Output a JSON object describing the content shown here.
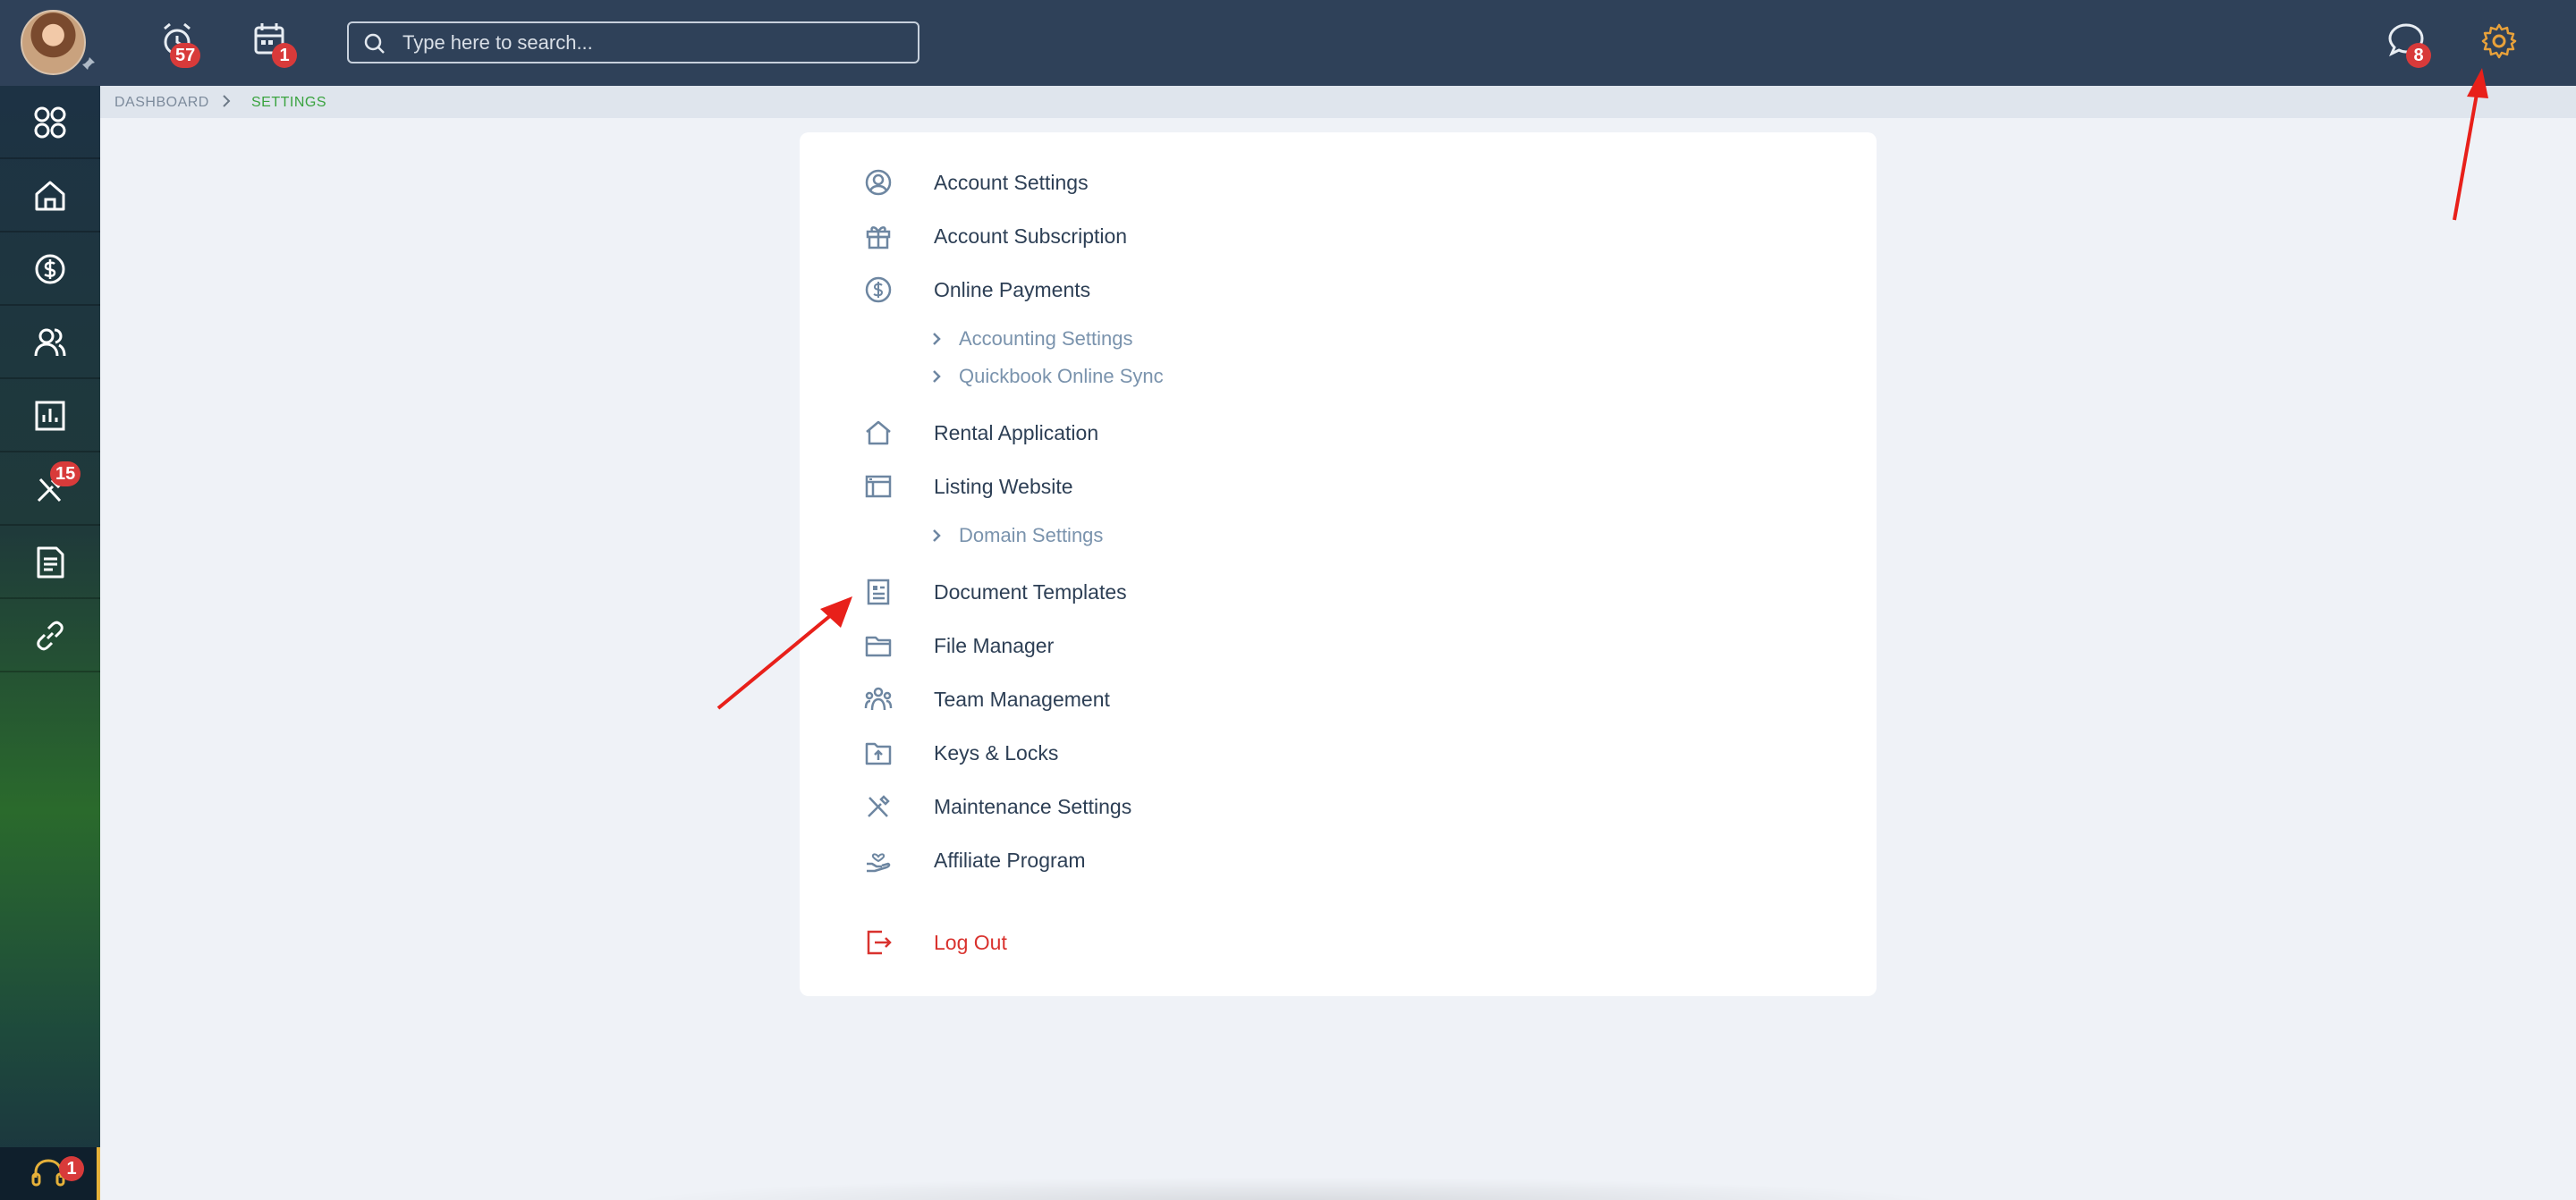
{
  "topbar": {
    "search_placeholder": "Type here to search...",
    "alarms_badge": "57",
    "calendar_badge": "1",
    "messages_badge": "8",
    "settings_color": "#e8a13a"
  },
  "sidebar": {
    "tools_badge": "15",
    "support_badge": "1",
    "items": [
      "dashboard-icon",
      "home-icon",
      "dollar-icon",
      "users-icon",
      "chart-icon",
      "tools-icon",
      "document-icon",
      "link-icon"
    ]
  },
  "breadcrumb": {
    "root": "DASHBOARD",
    "current": "SETTINGS"
  },
  "menu": {
    "account_settings": "Account Settings",
    "account_subscription": "Account Subscription",
    "online_payments": "Online Payments",
    "accounting_settings": "Accounting Settings",
    "quickbook_sync": "Quickbook Online Sync",
    "rental_application": "Rental Application",
    "listing_website": "Listing Website",
    "domain_settings": "Domain Settings",
    "document_templates": "Document Templates",
    "file_manager": "File Manager",
    "team_management": "Team Management",
    "keys_locks": "Keys & Locks",
    "maintenance_settings": "Maintenance Settings",
    "affiliate_program": "Affiliate Program",
    "log_out": "Log Out"
  },
  "colors": {
    "topbar": "#2f4159",
    "accent_green": "#3aa33f",
    "danger": "#d9322e",
    "annotation": "#e8201a"
  }
}
